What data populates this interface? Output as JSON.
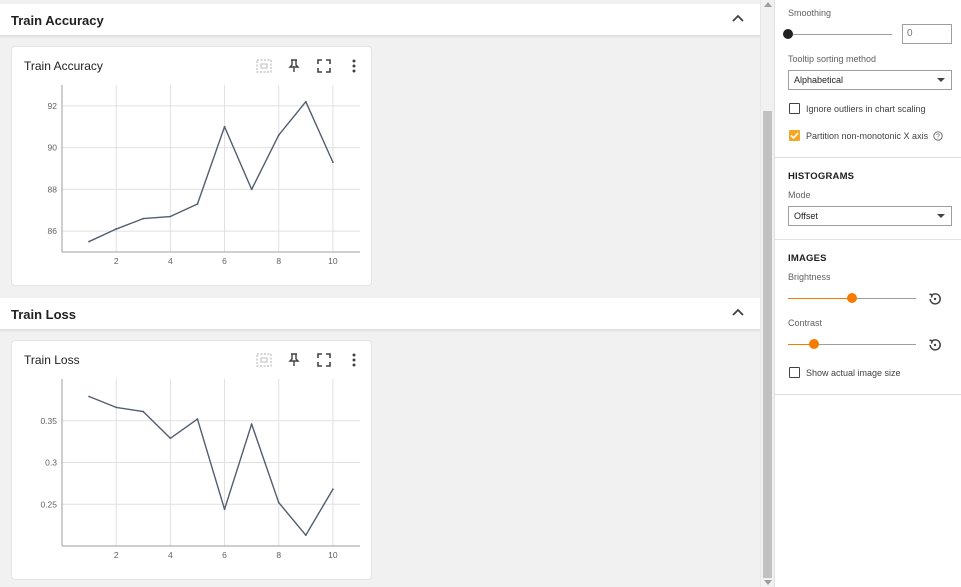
{
  "groups": [
    {
      "title": "Train Accuracy",
      "card_title": "Train Accuracy",
      "chart_data": {
        "type": "line",
        "title": "Train Accuracy",
        "x": [
          1,
          2,
          3,
          4,
          5,
          6,
          7,
          8,
          9,
          10
        ],
        "series": [
          {
            "values": [
              85.5,
              86.1,
              86.6,
              86.7,
              87.3,
              91.0,
              88.0,
              90.6,
              92.2,
              89.3
            ]
          }
        ],
        "xlim": [
          0,
          11
        ],
        "ylim": [
          85,
          93
        ],
        "xticks": [
          2,
          4,
          6,
          8,
          10
        ],
        "yticks": [
          86,
          88,
          90,
          92
        ],
        "xticklabels": [
          "2",
          "4",
          "6",
          "8",
          "10"
        ],
        "yticklabels": [
          "86",
          "88",
          "90",
          "92"
        ],
        "grid": true,
        "line_color": "#525d70"
      }
    },
    {
      "title": "Train Loss",
      "card_title": "Train Loss",
      "chart_data": {
        "type": "line",
        "title": "Train Loss",
        "x": [
          1,
          2,
          3,
          4,
          5,
          6,
          7,
          8,
          9,
          10
        ],
        "series": [
          {
            "values": [
              0.379,
              0.366,
              0.361,
              0.329,
              0.352,
              0.244,
              0.346,
              0.252,
              0.213,
              0.268
            ]
          }
        ],
        "xlim": [
          0,
          11
        ],
        "ylim": [
          0.2,
          0.4
        ],
        "xticks": [
          2,
          4,
          6,
          8,
          10
        ],
        "yticks": [
          0.25,
          0.3,
          0.35
        ],
        "xticklabels": [
          "2",
          "4",
          "6",
          "8",
          "10"
        ],
        "yticklabels": [
          "0.25",
          "0.3",
          "0.35"
        ],
        "grid": true,
        "line_color": "#525d70"
      }
    }
  ],
  "card_tools": {
    "fit_icon": "fit-domain-icon",
    "pin_icon": "pin-icon",
    "fullscreen_icon": "fullscreen-icon",
    "more_icon": "more-vert-icon"
  },
  "settings": {
    "smoothing": {
      "label": "Smoothing",
      "value": "0",
      "slider_fraction": 0
    },
    "tooltip_sort": {
      "label": "Tooltip sorting method",
      "selected": "Alphabetical"
    },
    "ignore_outliers": {
      "label": "Ignore outliers in chart scaling",
      "checked": false
    },
    "partition_x": {
      "label": "Partition non-monotonic X axis",
      "checked": true
    },
    "histograms": {
      "heading": "HISTOGRAMS",
      "mode_label": "Mode",
      "mode_selected": "Offset"
    },
    "images": {
      "heading": "IMAGES",
      "brightness_label": "Brightness",
      "brightness_fraction": 0.5,
      "contrast_label": "Contrast",
      "contrast_fraction": 0.2,
      "actual_size_label": "Show actual image size",
      "actual_size_checked": false
    }
  },
  "colors": {
    "accent": "#f57c00",
    "checkbox_checked": "#f5a623",
    "line": "#525d70"
  }
}
